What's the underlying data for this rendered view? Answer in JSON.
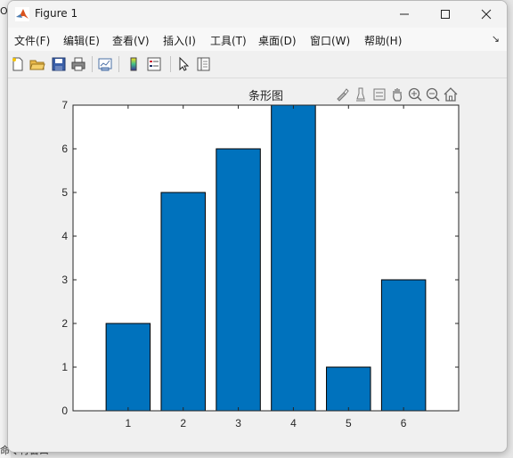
{
  "background": {
    "fragment_top": "O",
    "fragment_bottom": "命令行窗口"
  },
  "window": {
    "title": "Figure 1",
    "icons": {
      "app": "matlab-logo-icon",
      "minimize": "minimize-icon",
      "maximize": "maximize-icon",
      "close": "close-icon"
    }
  },
  "menu": {
    "items": [
      {
        "label": "文件(F)"
      },
      {
        "label": "编辑(E)"
      },
      {
        "label": "查看(V)"
      },
      {
        "label": "插入(I)"
      },
      {
        "label": "工具(T)"
      },
      {
        "label": "桌面(D)"
      },
      {
        "label": "窗口(W)"
      },
      {
        "label": "帮助(H)"
      }
    ],
    "overflow_arrow": "↘"
  },
  "toolbar": {
    "icons": [
      "new-figure-icon",
      "open-file-icon",
      "save-icon",
      "print-icon",
      "link-plot-icon",
      "insert-colorbar-icon",
      "insert-legend-icon",
      "edit-plot-arrow-icon",
      "property-inspector-icon"
    ]
  },
  "axes_toolbar": {
    "icons": [
      "brush-icon",
      "data-tips-icon",
      "restore-view-icon",
      "pan-icon",
      "zoom-in-icon",
      "zoom-out-icon",
      "home-icon"
    ]
  },
  "chart_data": {
    "type": "bar",
    "title": "条形图",
    "categories": [
      1,
      2,
      3,
      4,
      5,
      6
    ],
    "values": [
      2,
      5,
      6,
      7,
      1,
      3
    ],
    "xlim": [
      0,
      7
    ],
    "ylim": [
      0,
      7
    ],
    "yticks": [
      0,
      1,
      2,
      3,
      4,
      5,
      6,
      7
    ],
    "xticks": [
      1,
      2,
      3,
      4,
      5,
      6
    ],
    "bar_color": "#0072BD",
    "grid": false,
    "xlabel": "",
    "ylabel": ""
  },
  "colors": {
    "window_bg": "#f0f0f0",
    "axes_bg": "#ffffff",
    "bar_fill": "#0072BD"
  }
}
